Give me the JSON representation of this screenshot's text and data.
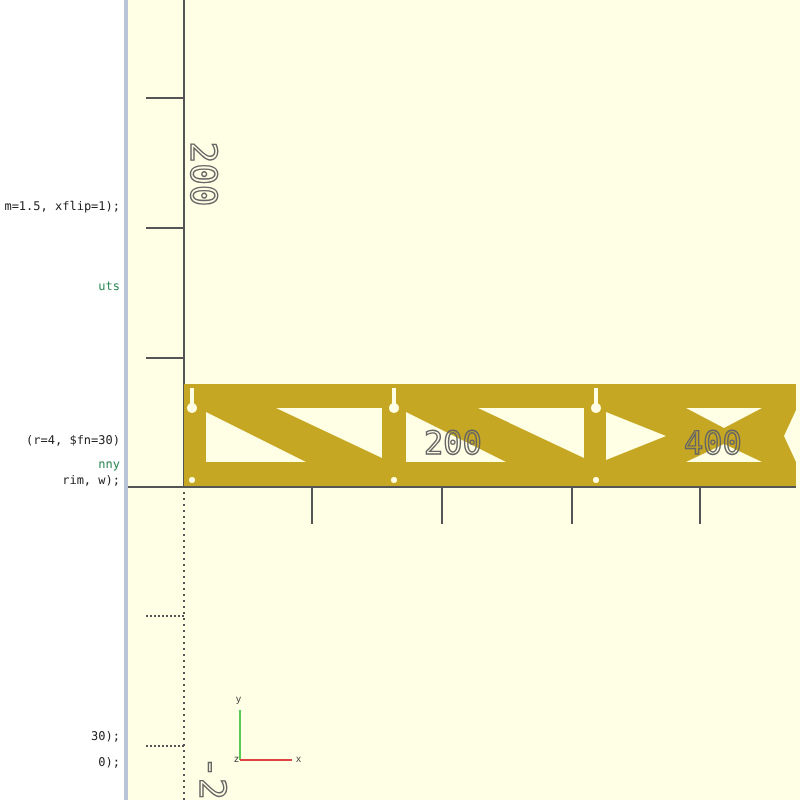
{
  "editor": {
    "lines": [
      {
        "text": "m=1.5, xflip=1);",
        "kind": "code"
      },
      {
        "text": "uts",
        "kind": "comment"
      },
      {
        "text": "(r=4, $fn=30)",
        "kind": "code"
      },
      {
        "text": "nny",
        "kind": "comment"
      },
      {
        "text": "rim, w);",
        "kind": "code"
      },
      {
        "text": "30);",
        "kind": "code"
      },
      {
        "text": "0);",
        "kind": "code"
      }
    ]
  },
  "viewport": {
    "axis_labels": [
      {
        "text": "200",
        "kind": "vertical"
      },
      {
        "text": "200",
        "kind": "horizontal"
      },
      {
        "text": "400",
        "kind": "horizontal"
      },
      {
        "text": "-2",
        "kind": "vertical"
      }
    ],
    "gizmo": {
      "x": "x",
      "y": "y",
      "z": "z"
    }
  }
}
